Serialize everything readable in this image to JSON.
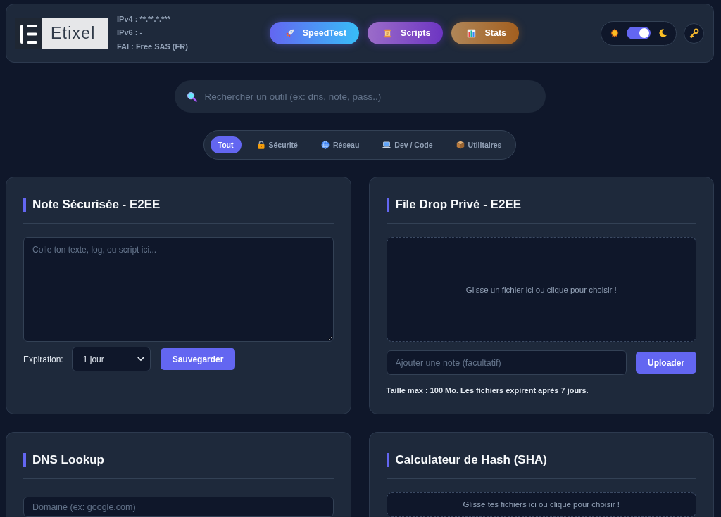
{
  "header": {
    "logo": {
      "text": "Etixel"
    },
    "connection_info": [
      "IPv4 : **.**.*.***",
      "IPv6 : -",
      "FAI : Free SAS (FR)"
    ],
    "nav_buttons": [
      {
        "label": "SpeedTest",
        "kind": "speedtest"
      },
      {
        "label": "Scripts",
        "kind": "scripts"
      },
      {
        "label": "Stats",
        "kind": "stats"
      }
    ],
    "theme_toggle": {
      "on": true
    }
  },
  "search": {
    "placeholder": "Rechercher un outil (ex: dns, note, pass..)"
  },
  "filters": [
    {
      "label": "Tout",
      "kind": "all",
      "selected": true
    },
    {
      "label": "Sécurité",
      "kind": "security",
      "selected": false
    },
    {
      "label": "Réseau",
      "kind": "network",
      "selected": false
    },
    {
      "label": "Dev / Code",
      "kind": "code",
      "selected": false
    },
    {
      "label": "Utilitaires",
      "kind": "tools",
      "selected": false
    }
  ],
  "cards": [
    {
      "title": "Note Sécurisée - E2EE",
      "textarea": {
        "placeholder": "Colle ton texte, log, ou script ici..."
      },
      "expiration": {
        "label": "Expiration:",
        "value": "1 jour"
      },
      "button": "Sauvegarder"
    },
    {
      "title": "File Drop Privé - E2EE",
      "dropzone": "Glisse un fichier ici ou clique pour choisir !",
      "note_input": {
        "placeholder": "Ajouter une note (facultatif)"
      },
      "button": "Uploader",
      "info": "Taille max : 100 Mo. Les fichiers expirent après 7 jours."
    },
    {
      "title": "DNS Lookup",
      "input": {
        "placeholder": "Domaine (ex: google.com)"
      }
    },
    {
      "title": "Calculateur de Hash (SHA)",
      "dropzone": "Glisse tes fichiers ici ou clique pour choisir !"
    }
  ]
}
